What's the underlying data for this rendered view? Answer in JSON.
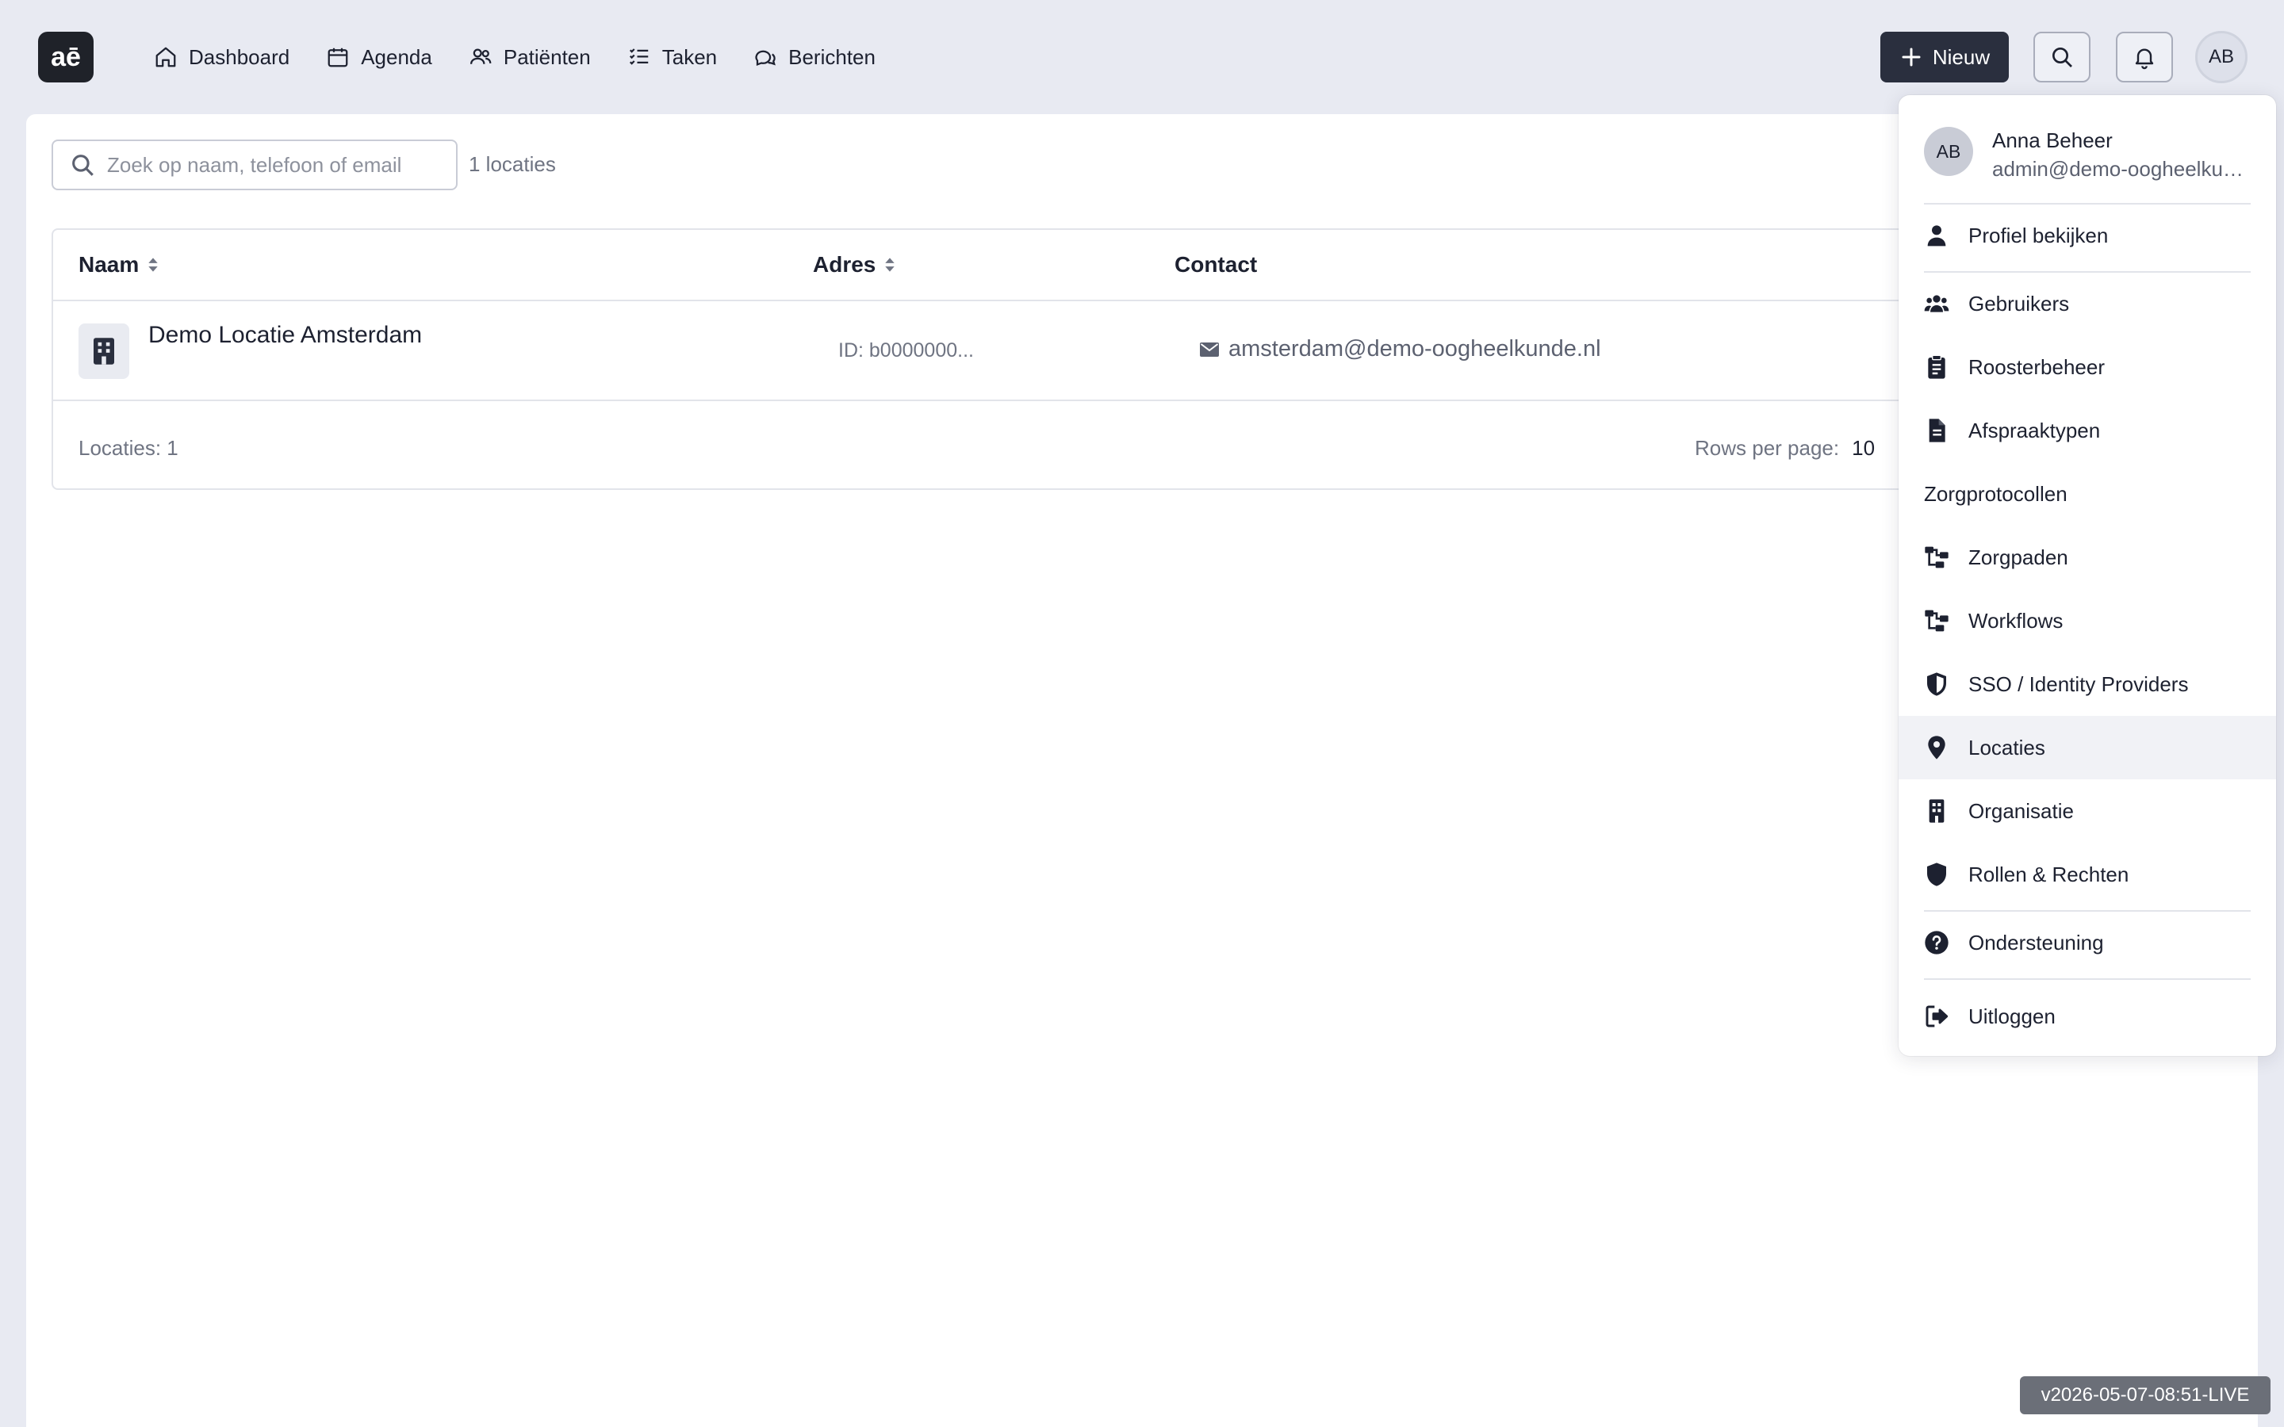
{
  "app": {
    "logo_text": "aē"
  },
  "nav": {
    "items": [
      {
        "label": "Dashboard",
        "icon": "home-icon"
      },
      {
        "label": "Agenda",
        "icon": "calendar-icon"
      },
      {
        "label": "Patiënten",
        "icon": "users-icon"
      },
      {
        "label": "Taken",
        "icon": "tasks-icon"
      },
      {
        "label": "Berichten",
        "icon": "chat-icon"
      }
    ],
    "new_label": "Nieuw",
    "avatar_initials": "AB"
  },
  "search": {
    "placeholder": "Zoek op naam, telefoon of email"
  },
  "locations_count": "1 locaties",
  "table": {
    "columns": [
      "Naam",
      "Adres",
      "Contact"
    ],
    "rows": [
      {
        "name": "Demo Locatie Amsterdam",
        "address": "ID: b0000000...",
        "email": "amsterdam@demo-oogheelkunde.nl"
      }
    ],
    "footer_count": "Locaties: 1",
    "rows_per_page_label": "Rows per page:",
    "rows_per_page_value": "10"
  },
  "menu": {
    "user": {
      "initials": "AB",
      "name": "Anna Beheer",
      "email": "admin@demo-oogheelkunde.nl"
    },
    "profile": "Profiel bekijken",
    "users": "Gebruikers",
    "schedule": "Roosterbeheer",
    "appointment_types": "Afspraaktypen",
    "section_protocols": "Zorgprotocollen",
    "care_paths": "Zorgpaden",
    "workflows": "Workflows",
    "sso": "SSO / Identity Providers",
    "locations": "Locaties",
    "organization": "Organisatie",
    "roles": "Rollen & Rechten",
    "support": "Ondersteuning",
    "logout": "Uitloggen"
  },
  "version": "v2026-05-07-08:51-LIVE",
  "colors": {
    "dark": "#2a2f3e",
    "background": "#e8eaf2",
    "active_row": "#f1f2f6"
  }
}
